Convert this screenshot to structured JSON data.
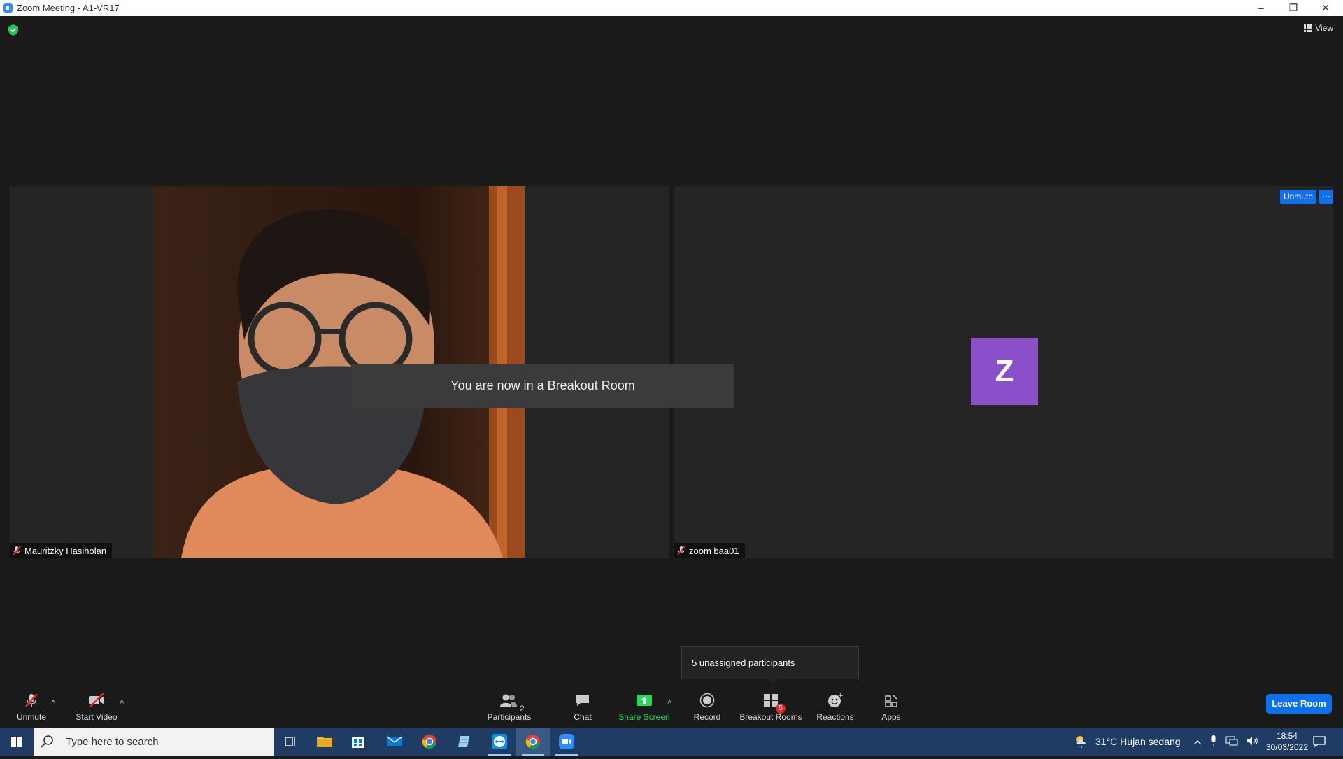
{
  "window": {
    "title": "Zoom Meeting - A1-VR17",
    "minimize": "–",
    "restore": "❐",
    "close": "✕"
  },
  "meeting": {
    "view_label": "View",
    "toast": "You are now in a Breakout Room",
    "tiles": [
      {
        "name": "Mauritzky Hasiholan"
      },
      {
        "name": "zoom baa01",
        "avatar_letter": "Z",
        "unmute_label": "Unmute",
        "more_label": "···"
      }
    ],
    "tooltip": "5 unassigned participants"
  },
  "toolbar": {
    "unmute": "Unmute",
    "start_video": "Start Video",
    "participants": "Participants",
    "participants_count": "2",
    "chat": "Chat",
    "share_screen": "Share Screen",
    "record": "Record",
    "breakout_rooms": "Breakout Rooms",
    "breakout_badge": "5",
    "reactions": "Reactions",
    "apps": "Apps",
    "leave": "Leave Room",
    "caret": "˄"
  },
  "taskbar": {
    "search_placeholder": "Type here to search",
    "weather": "31°C  Hujan sedang",
    "time": "18:54",
    "date": "30/03/2022"
  },
  "colors": {
    "accent": "#0e71eb",
    "share_green": "#23d959",
    "avatar": "#8a4fc9",
    "badge": "#e02828",
    "taskbar": "#1f3c64"
  }
}
